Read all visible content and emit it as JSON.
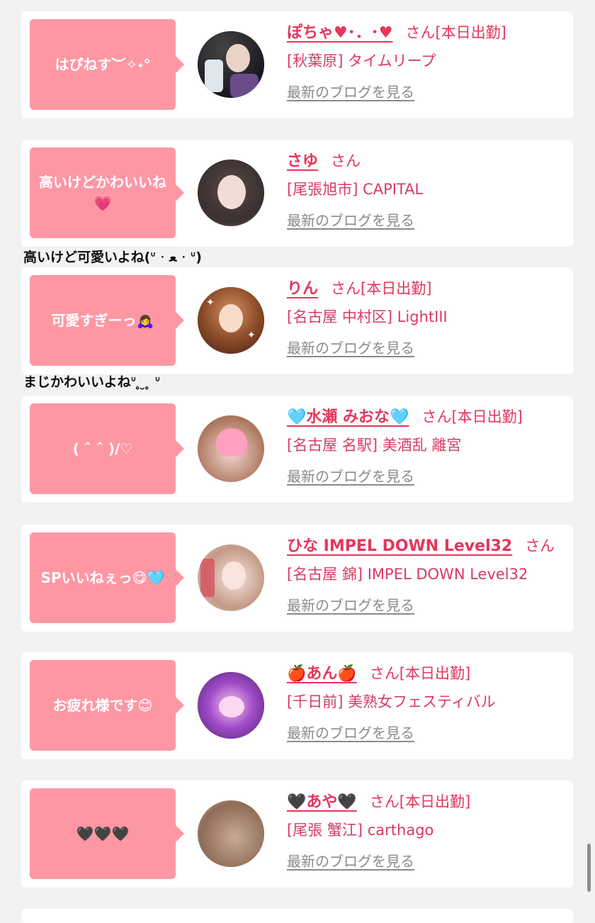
{
  "cards": [
    {
      "message": "はぴねす︶✧˖°",
      "name": "ぽちゃ♥︎･．･♥︎",
      "honorific": "さん[本日出勤]",
      "shop": "[秋葉原] タイムリープ",
      "blog_link": "最新のブログを見る"
    },
    {
      "message": "高いけどかわいいね💗",
      "name": "さゆ",
      "honorific": "さん",
      "shop": "[尾張旭市] CAPITAL",
      "blog_link": "最新のブログを見る"
    },
    {
      "message": "可愛すぎーっ🙇‍♀️",
      "name": "りん",
      "honorific": "さん[本日出勤]",
      "shop": "[名古屋 中村区] LightIII",
      "blog_link": "最新のブログを見る"
    },
    {
      "message": "( ˆ ˆ )/♡",
      "name": "🩵水瀬 みおな🩵",
      "honorific": "さん[本日出勤]",
      "shop": "[名古屋 名駅] 美酒乱 離宮",
      "blog_link": "最新のブログを見る"
    },
    {
      "message": "SPいいねぇっ😋🩵",
      "name": "ひな IMPEL DOWN Level32",
      "honorific": "さん",
      "shop": "[名古屋 錦] IMPEL DOWN Level32",
      "blog_link": "最新のブログを見る"
    },
    {
      "message": "お疲れ様です😊",
      "name": "🍎あん🍎",
      "honorific": "さん[本日出勤]",
      "shop": "[千日前] 美熟女フェスティバル",
      "blog_link": "最新のブログを見る"
    },
    {
      "message": "🖤🖤🖤",
      "name": "🖤あや🖤",
      "honorific": "さん[本日出勤]",
      "shop": "[尾張 蟹江] carthago",
      "blog_link": "最新のブログを見る"
    }
  ],
  "comments": [
    "高いけど可愛いよね(ᐡ ᐧ ﻌ ᐧ ᐡ)",
    "まじかわいいよねᐡ ̥ ̮ ̥ ᐡ"
  ],
  "colors": {
    "bubble": "#fe97a4",
    "name": "#e5365c",
    "shop": "#d93a62",
    "blog": "#8a8a8a",
    "background": "#f2f2f2"
  },
  "icons": [
    "avatar-photo"
  ]
}
